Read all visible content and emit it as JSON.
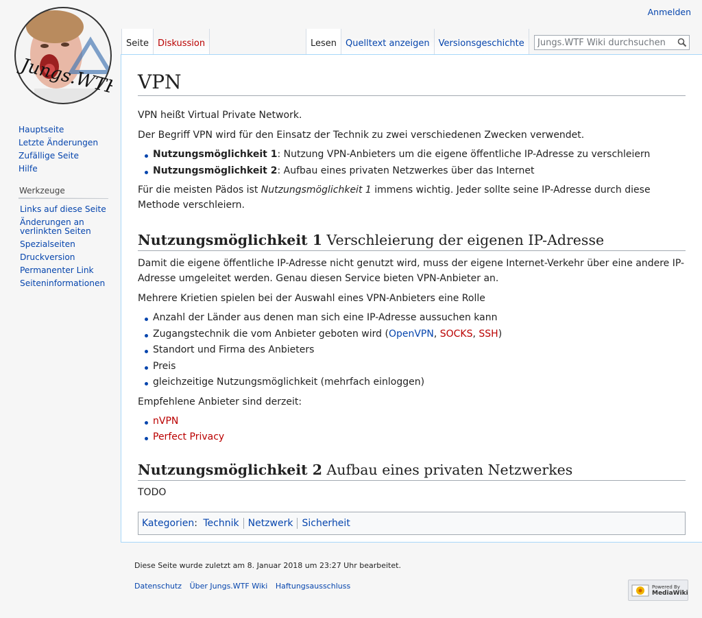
{
  "logo": {
    "text": "Jungs.WTF"
  },
  "personal": {
    "login": "Anmelden"
  },
  "tabs": {
    "left": [
      "Seite",
      "Diskussion"
    ],
    "right": [
      "Lesen",
      "Quelltext anzeigen",
      "Versionsgeschichte"
    ]
  },
  "search": {
    "placeholder": "Jungs.WTF Wiki durchsuchen"
  },
  "sidebar": {
    "navigation": [
      "Hauptseite",
      "Letzte Änderungen",
      "Zufällige Seite",
      "Hilfe"
    ],
    "tools_heading": "Werkzeuge",
    "tools": [
      "Links auf diese Seite",
      "Änderungen an verlinkten Seiten",
      "Spezialseiten",
      "Druckversion",
      "Permanenter Link",
      "Seiteninformationen"
    ]
  },
  "article": {
    "title": "VPN",
    "p1": "VPN heißt Virtual Private Network.",
    "p2": "Der Begriff VPN wird für den Einsatz der Technik zu zwei verschiedenen Zwecken verwendet.",
    "uses": [
      {
        "label": "Nutzungsmöglichkeit 1",
        "text": ": Nutzung VPN-Anbieters um die eigene öffentliche IP-Adresse zu verschleiern"
      },
      {
        "label": "Nutzungsmöglichkeit 2",
        "text": ": Aufbau eines privaten Netzwerkes über das Internet"
      }
    ],
    "p3_a": "Für die meisten Pädos ist ",
    "p3_em": "Nutzungsmöglichkeit 1",
    "p3_b": " immens wichtig. Jeder sollte seine IP-Adresse durch diese Methode verschleiern.",
    "h2a_bold": "Nutzungsmöglichkeit 1",
    "h2a_text": " Verschleierung der eigenen IP-Adresse",
    "p4": "Damit die eigene öffentliche IP-Adresse nicht genutzt wird, muss der eigene Internet-Verkehr über eine andere IP-Adresse umgeleitet werden. Genau diesen Service bieten VPN-Anbieter an.",
    "p5": "Mehrere Krietien spielen bei der Auswahl eines VPN-Anbieters eine Rolle",
    "criteria1": "Anzahl der Länder aus denen man sich eine IP-Adresse aussuchen kann",
    "criteria2_a": "Zugangstechnik die vom Anbieter geboten wird (",
    "criteria2_l1": "OpenVPN",
    "criteria2_sep1": ", ",
    "criteria2_l2": "SOCKS",
    "criteria2_sep2": ", ",
    "criteria2_l3": "SSH",
    "criteria2_b": ")",
    "criteria3": "Standort und Firma des Anbieters",
    "criteria4": "Preis",
    "criteria5": "gleichzeitige Nutzungsmöglichkeit (mehrfach einloggen)",
    "p6": "Empfehlene Anbieter sind derzeit:",
    "providers": [
      "nVPN",
      "Perfect Privacy"
    ],
    "h2b_bold": "Nutzungsmöglichkeit 2",
    "h2b_text": " Aufbau eines privaten Netzwerkes",
    "p7": "TODO",
    "categories_label": "Kategorien",
    "categories_colon": ":",
    "categories": [
      "Technik",
      "Netzwerk",
      "Sicherheit"
    ]
  },
  "footer": {
    "last_modified": "Diese Seite wurde zuletzt am 8. Januar 2018 um 23:27 Uhr bearbeitet.",
    "links": [
      "Datenschutz",
      "Über Jungs.WTF Wiki",
      "Haftungsausschluss"
    ],
    "powered_small": "Powered By",
    "powered_name": "MediaWiki"
  },
  "colors": {
    "link": "#0645ad",
    "newlink": "#ba0000",
    "border": "#a7d7f9"
  }
}
